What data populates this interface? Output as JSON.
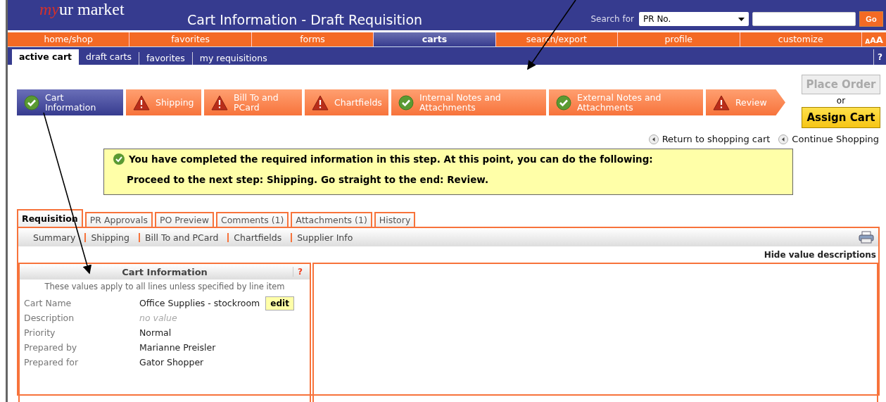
{
  "header": {
    "logo_prefix": "my",
    "logo_name": "ur market",
    "title": "Cart Information - Draft Requisition",
    "search_label": "Search for",
    "search_select": "PR No.",
    "search_button": "Go"
  },
  "nav": [
    {
      "label": "home/shop",
      "selected": false
    },
    {
      "label": "favorites",
      "selected": false
    },
    {
      "label": "forms",
      "selected": false
    },
    {
      "label": "carts",
      "selected": true
    },
    {
      "label": "search/export",
      "selected": false
    },
    {
      "label": "profile",
      "selected": false
    },
    {
      "label": "customize",
      "selected": false
    }
  ],
  "font_sizes": [
    "A",
    "A",
    "A"
  ],
  "subnav": [
    {
      "label": "active cart",
      "selected": true
    },
    {
      "label": "draft carts",
      "selected": false
    },
    {
      "label": "favorites",
      "selected": false
    },
    {
      "label": "my requisitions",
      "selected": false
    }
  ],
  "subnav_help": "?",
  "steps": [
    {
      "label": "Cart Information",
      "complete": true,
      "selected": true
    },
    {
      "label": "Shipping",
      "complete": false,
      "selected": false
    },
    {
      "label": "Bill To and PCard",
      "complete": false,
      "selected": false
    },
    {
      "label": "Chartfields",
      "complete": false,
      "selected": false
    },
    {
      "label": "Internal Notes and Attachments",
      "complete": true,
      "selected": false
    },
    {
      "label": "External Notes and Attachments",
      "complete": true,
      "selected": false
    },
    {
      "label": "Review",
      "complete": false,
      "selected": false
    }
  ],
  "actions": {
    "place_order": "Place Order",
    "place_order_disabled": true,
    "or": "or",
    "assign_cart": "Assign Cart"
  },
  "links": [
    "Return to shopping cart",
    "Continue Shopping"
  ],
  "message": [
    "You have completed the required information in this step. At this point, you can do the following:",
    "Proceed to the next step: Shipping. Go straight to the end: Review."
  ],
  "tabs": [
    {
      "label": "Requisition",
      "selected": true
    },
    {
      "label": "PR Approvals",
      "selected": false
    },
    {
      "label": "PO Preview",
      "selected": false
    },
    {
      "label": "Comments (1)",
      "selected": false
    },
    {
      "label": "Attachments (1)",
      "selected": false
    },
    {
      "label": "History",
      "selected": false
    }
  ],
  "subtabs": [
    "Summary",
    "Shipping",
    "Bill To and PCard",
    "Chartfields",
    "Supplier Info"
  ],
  "hide_link": "Hide value descriptions",
  "panel": {
    "title": "Cart Information",
    "help": "?",
    "note": "These values apply to all lines unless specified by line item",
    "fields": [
      {
        "label": "Cart Name",
        "value": "Office Supplies - stockroom",
        "empty": false,
        "action": "edit"
      },
      {
        "label": "Description",
        "value": "no value",
        "empty": true
      },
      {
        "label": "Priority",
        "value": "Normal",
        "empty": false
      },
      {
        "label": "Prepared by",
        "value": "Marianne Preisler",
        "empty": false
      },
      {
        "label": "Prepared for",
        "value": "Gator Shopper",
        "empty": false
      }
    ]
  }
}
